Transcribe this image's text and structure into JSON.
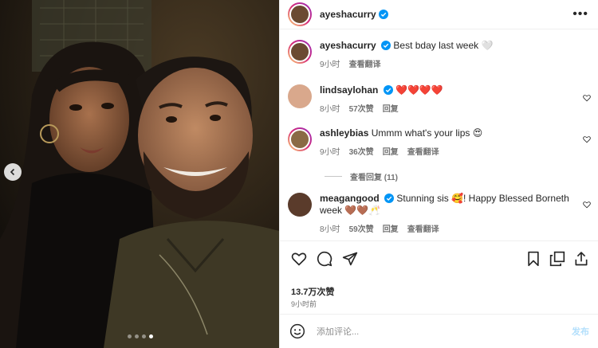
{
  "post": {
    "author": "ayeshacurry",
    "more_label": "•••",
    "caption": "Best bday last week 🤍",
    "caption_time": "9小时",
    "see_translation": "查看翻译"
  },
  "comments": [
    {
      "user": "lindsaylohan",
      "verified": true,
      "text": "❤️❤️❤️❤️",
      "time": "8小时",
      "likes": "57次赞",
      "reply": "回复"
    },
    {
      "user": "ashleybias",
      "verified": false,
      "text": "Ummm what's your lips 😍",
      "time": "9小时",
      "likes": "36次赞",
      "reply": "回复",
      "translate": "查看翻译"
    },
    {
      "user": "meagangood",
      "verified": true,
      "text": "Stunning sis 🥰! Happy Blessed Borneth week 🤎🤎🥂",
      "time": "8小时",
      "likes": "59次赞",
      "reply": "回复",
      "translate": "查看翻译"
    }
  ],
  "view_replies": "查看回复 (11)",
  "stats": {
    "likes": "13.7万次赞",
    "posted": "9小时前"
  },
  "composer": {
    "placeholder": "添加评论...",
    "post_label": "发布"
  },
  "carousel": {
    "slide_count": 4,
    "active_index": 3
  },
  "colors": {
    "verified": "#0095f6",
    "ring_start": "#feda75",
    "ring_end": "#962fbf"
  }
}
